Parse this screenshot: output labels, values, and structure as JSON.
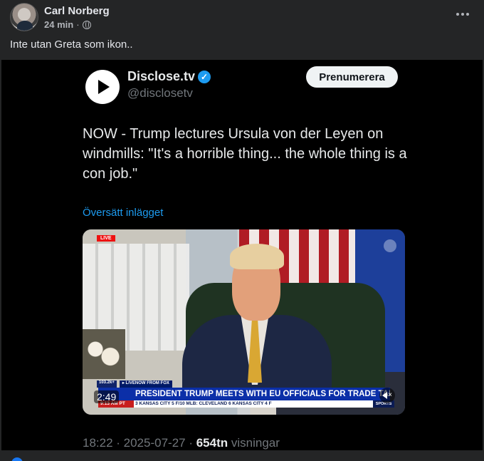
{
  "post": {
    "author": "Carl Norberg",
    "time": "24 min",
    "separator": "·",
    "privacy_icon": "globe-icon",
    "more_icon": "more-horizontal-icon",
    "text": "Inte utan Greta som ikon.."
  },
  "tweet": {
    "display_name": "Disclose.tv",
    "verified_icon": "verified-badge-icon",
    "verified_glyph": "✓",
    "handle": "@disclosetv",
    "subscribe_label": "Prenumerera",
    "text": "NOW - Trump lectures Ursula von der Leyen on windmills: \"It's a horrible thing... the whole thing is a con job.\"",
    "translate_label": "Översätt inlägget",
    "timestamp": "18:22 · 2025-07-27 · ",
    "views_count": "654tn",
    "views_label": " visningar",
    "accent_color": "#1d9bf0"
  },
  "video": {
    "duration": "2:49",
    "live_tag": "LIVE",
    "views_badge": "103.2k+",
    "source_badge": "▸ LIVENOW FROM FOX",
    "headline": "PRESIDENT TRUMP MEETS WITH EU OFFICIALS FOR TRADE TALKS",
    "clock": "9:13 AM PT",
    "ticker": "3  KANSAS CITY  5  F/10      MLB:  CLEVELAND  6  KANSAS CITY  4  F",
    "sports_label": "SPORTS"
  }
}
